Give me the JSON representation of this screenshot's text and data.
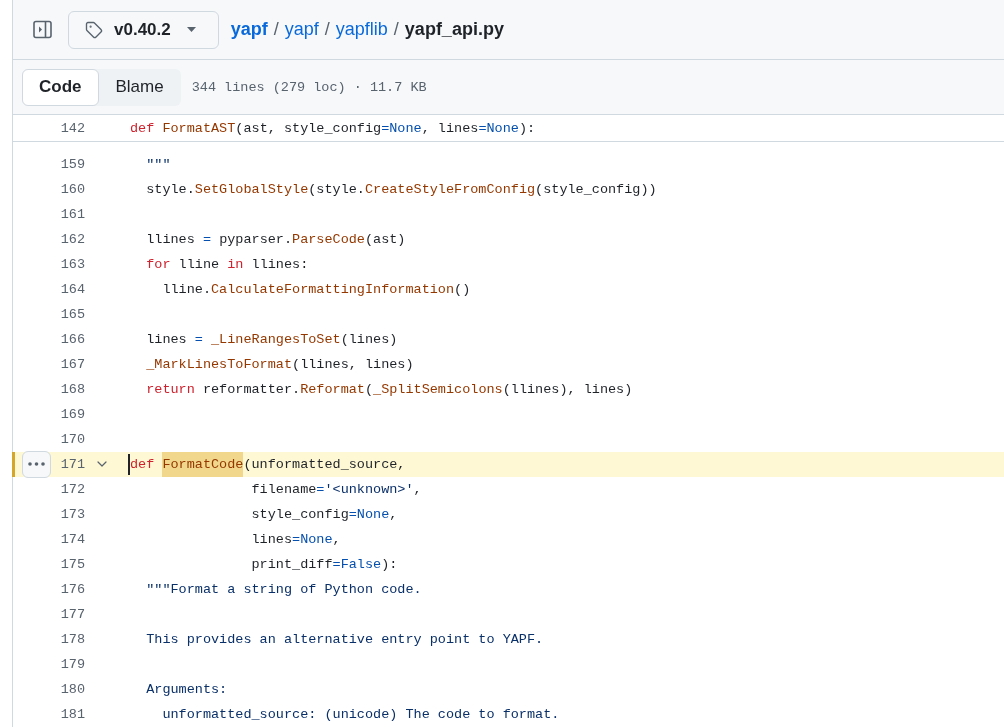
{
  "header": {
    "ref_button": {
      "label": "v0.40.2"
    },
    "breadcrumb": [
      {
        "kind": "repo",
        "text": "yapf"
      },
      {
        "kind": "separator",
        "text": "/"
      },
      {
        "kind": "dir",
        "text": "yapf"
      },
      {
        "kind": "separator",
        "text": "/"
      },
      {
        "kind": "dir",
        "text": "yapflib"
      },
      {
        "kind": "separator",
        "text": "/"
      },
      {
        "kind": "file",
        "text": "yapf_api.py"
      }
    ]
  },
  "toolbar": {
    "tabs": [
      {
        "label": "Code",
        "selected": true
      },
      {
        "label": "Blame",
        "selected": false
      }
    ],
    "file_info": "344 lines (279 loc) · 11.7 KB"
  },
  "sticky_line": {
    "number": "142",
    "tokens": [
      {
        "kind": "keyword",
        "text": "def "
      },
      {
        "kind": "function",
        "text": "FormatAST"
      },
      {
        "kind": "plain",
        "text": "(ast, style_config"
      },
      {
        "kind": "operator",
        "text": "="
      },
      {
        "kind": "constant",
        "text": "None"
      },
      {
        "kind": "plain",
        "text": ", lines"
      },
      {
        "kind": "operator",
        "text": "="
      },
      {
        "kind": "constant",
        "text": "None"
      },
      {
        "kind": "plain",
        "text": "):"
      }
    ]
  },
  "lines": [
    {
      "number": "159",
      "selected": false,
      "tokens": [
        {
          "kind": "string",
          "text": "  \"\"\""
        }
      ]
    },
    {
      "number": "160",
      "selected": false,
      "tokens": [
        {
          "kind": "plain",
          "text": "  style."
        },
        {
          "kind": "function",
          "text": "SetGlobalStyle"
        },
        {
          "kind": "plain",
          "text": "(style."
        },
        {
          "kind": "function",
          "text": "CreateStyleFromConfig"
        },
        {
          "kind": "plain",
          "text": "(style_config))"
        }
      ]
    },
    {
      "number": "161",
      "selected": false
    },
    {
      "number": "162",
      "selected": false,
      "tokens": [
        {
          "kind": "plain",
          "text": "  llines "
        },
        {
          "kind": "operator",
          "text": "="
        },
        {
          "kind": "plain",
          "text": " pyparser."
        },
        {
          "kind": "function",
          "text": "ParseCode"
        },
        {
          "kind": "plain",
          "text": "(ast)"
        }
      ]
    },
    {
      "number": "163",
      "selected": false,
      "tokens": [
        {
          "kind": "keyword",
          "text": "  for"
        },
        {
          "kind": "plain",
          "text": " lline "
        },
        {
          "kind": "keyword",
          "text": "in"
        },
        {
          "kind": "plain",
          "text": " llines:"
        }
      ]
    },
    {
      "number": "164",
      "selected": false,
      "tokens": [
        {
          "kind": "plain",
          "text": "    lline."
        },
        {
          "kind": "function",
          "text": "CalculateFormattingInformation"
        },
        {
          "kind": "plain",
          "text": "()"
        }
      ]
    },
    {
      "number": "165",
      "selected": false
    },
    {
      "number": "166",
      "selected": false,
      "tokens": [
        {
          "kind": "plain",
          "text": "  lines "
        },
        {
          "kind": "operator",
          "text": "="
        },
        {
          "kind": "function",
          "text": " _LineRangesToSet"
        },
        {
          "kind": "plain",
          "text": "(lines)"
        }
      ]
    },
    {
      "number": "167",
      "selected": false,
      "tokens": [
        {
          "kind": "function",
          "text": "  _MarkLinesToFormat"
        },
        {
          "kind": "plain",
          "text": "(llines, lines)"
        }
      ]
    },
    {
      "number": "168",
      "selected": false,
      "tokens": [
        {
          "kind": "keyword",
          "text": "  return"
        },
        {
          "kind": "plain",
          "text": " reformatter."
        },
        {
          "kind": "function",
          "text": "Reformat"
        },
        {
          "kind": "plain",
          "text": "("
        },
        {
          "kind": "function",
          "text": "_SplitSemicolons"
        },
        {
          "kind": "plain",
          "text": "(llines), lines)"
        }
      ]
    },
    {
      "number": "169",
      "selected": false
    },
    {
      "number": "170",
      "selected": false
    },
    {
      "number": "171",
      "selected": true,
      "expanded": true,
      "tokens": [
        {
          "kind": "keyword",
          "text": "def ",
          "highlighted": false
        },
        {
          "kind": "function",
          "text": "FormatCode",
          "highlighted": true
        },
        {
          "kind": "plain",
          "text": "(unformatted_source,",
          "highlighted": false
        }
      ]
    },
    {
      "number": "172",
      "selected": false,
      "tokens": [
        {
          "kind": "plain",
          "text": "               filename"
        },
        {
          "kind": "operator",
          "text": "="
        },
        {
          "kind": "string",
          "text": "'<unknown>'"
        },
        {
          "kind": "plain",
          "text": ","
        }
      ]
    },
    {
      "number": "173",
      "selected": false,
      "tokens": [
        {
          "kind": "plain",
          "text": "               style_config"
        },
        {
          "kind": "operator",
          "text": "="
        },
        {
          "kind": "constant",
          "text": "None"
        },
        {
          "kind": "plain",
          "text": ","
        }
      ]
    },
    {
      "number": "174",
      "selected": false,
      "tokens": [
        {
          "kind": "plain",
          "text": "               lines"
        },
        {
          "kind": "operator",
          "text": "="
        },
        {
          "kind": "constant",
          "text": "None"
        },
        {
          "kind": "plain",
          "text": ","
        }
      ]
    },
    {
      "number": "175",
      "selected": false,
      "tokens": [
        {
          "kind": "plain",
          "text": "               print_diff"
        },
        {
          "kind": "operator",
          "text": "="
        },
        {
          "kind": "constant",
          "text": "False"
        },
        {
          "kind": "plain",
          "text": "):"
        }
      ]
    },
    {
      "number": "176",
      "selected": false,
      "tokens": [
        {
          "kind": "string",
          "text": "  \"\"\"Format a string of Python code."
        }
      ]
    },
    {
      "number": "177",
      "selected": false
    },
    {
      "number": "178",
      "selected": false,
      "tokens": [
        {
          "kind": "string",
          "text": "  This provides an alternative entry point to YAPF."
        }
      ]
    },
    {
      "number": "179",
      "selected": false
    },
    {
      "number": "180",
      "selected": false,
      "tokens": [
        {
          "kind": "string",
          "text": "  Arguments:"
        }
      ]
    },
    {
      "number": "181",
      "selected": false,
      "tokens": [
        {
          "kind": "string",
          "text": "    unformatted_source: (unicode) The code to format."
        }
      ]
    }
  ]
}
